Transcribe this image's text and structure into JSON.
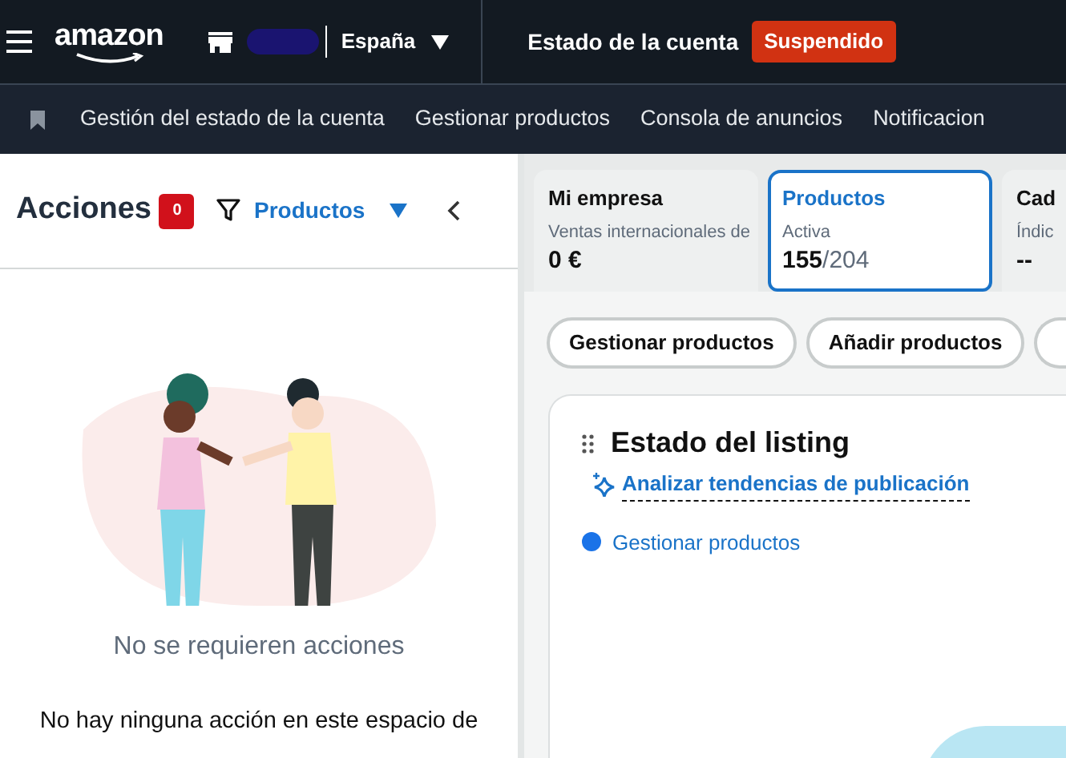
{
  "header": {
    "brand": "amazon",
    "marketplace": "España",
    "account_status_label": "Estado de la cuenta",
    "account_status": "Suspendido"
  },
  "nav": {
    "items": [
      "Gestión del estado de la cuenta",
      "Gestionar productos",
      "Consola de anuncios",
      "Notificacion"
    ]
  },
  "actions_panel": {
    "title": "Acciones",
    "count": "0",
    "filter": "Productos",
    "empty_title": "No se requieren acciones",
    "empty_text": "No hay ninguna acción en este espacio de"
  },
  "summary_cards": [
    {
      "title": "Mi empresa",
      "label": "Ventas internacionales de",
      "value": "0 €",
      "selected": false
    },
    {
      "title": "Productos",
      "label": "Activa",
      "value": "155",
      "total": "/204",
      "selected": true
    },
    {
      "title": "Cad",
      "label": "Índic",
      "value": "--",
      "selected": false
    }
  ],
  "action_buttons": [
    "Gestionar productos",
    "Añadir productos"
  ],
  "listing_card": {
    "title": "Estado del listing",
    "ai_link": "Analizar tendencias de publicación",
    "legend": [
      {
        "label": "Gestionar productos",
        "color": "#1a73e8"
      }
    ]
  }
}
